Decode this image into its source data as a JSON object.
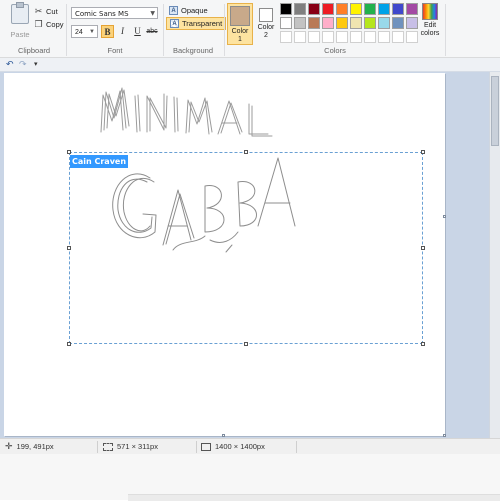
{
  "clipboard": {
    "paste_label": "Paste",
    "cut_label": "Cut",
    "copy_label": "Copy",
    "group_label": "Clipboard"
  },
  "font": {
    "family": "Comic Sans MS",
    "size": "24",
    "bold_label": "B",
    "italic_label": "I",
    "underline_label": "U",
    "strike_label": "abc",
    "group_label": "Font"
  },
  "background": {
    "opaque_label": "Opaque",
    "transparent_label": "Transparent",
    "selected": "Transparent",
    "group_label": "Background"
  },
  "colors": {
    "color1_label": "Color\n1",
    "color1_value": "#c8a98a",
    "color2_label": "Color\n2",
    "color2_value": "#ffffff",
    "palette": [
      "#000000",
      "#7f7f7f",
      "#880015",
      "#ed1c24",
      "#ff7f27",
      "#fff200",
      "#22b14c",
      "#00a2e8",
      "#3f48cc",
      "#a349a4",
      "#ffffff",
      "#c3c3c3",
      "#b97a57",
      "#ffaec9",
      "#ffc90e",
      "#efe4b0",
      "#b5e61d",
      "#99d9ea",
      "#7092be",
      "#c8bfe7",
      "#ffffff",
      "#ffffff",
      "#ffffff",
      "#ffffff",
      "#ffffff",
      "#ffffff",
      "#ffffff",
      "#ffffff",
      "#ffffff",
      "#ffffff"
    ],
    "edit_label": "Edit\ncolors",
    "group_label": "Colors"
  },
  "quick_access": {
    "undo_icon": "undo-icon",
    "redo_icon": "redo-icon",
    "customize_icon": "dropdown-icon"
  },
  "canvas": {
    "sketch_text_1": "MINIMAL",
    "sketch_text_2": "GABBA",
    "selected_text": "Cain Craven"
  },
  "status": {
    "cursor_position": "199, 491px",
    "selection_size": "571 × 311px",
    "image_size": "1400 × 1400px"
  }
}
